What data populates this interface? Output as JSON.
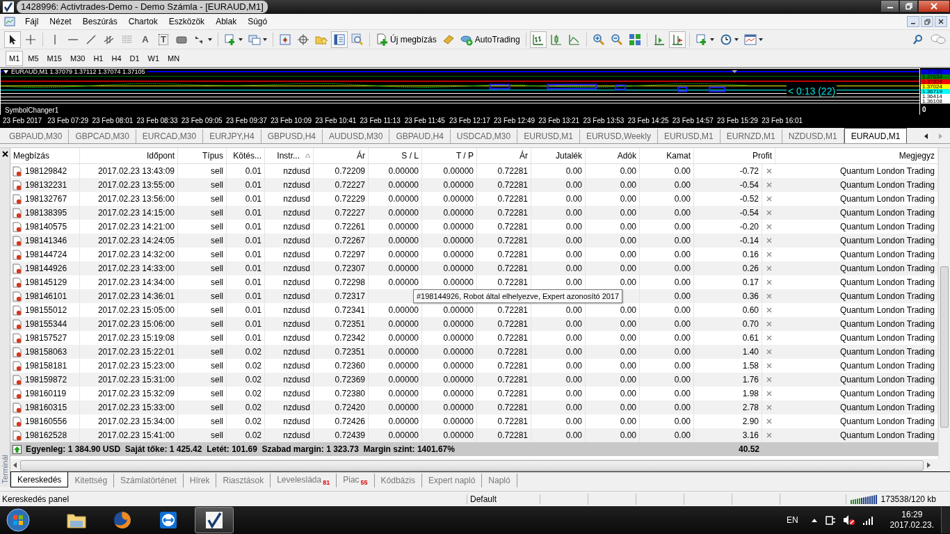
{
  "window": {
    "title": "1428996: Activtrades-Demo - Demo Számla - [EURAUD,M1]"
  },
  "menu": [
    "Fájl",
    "Nézet",
    "Beszúrás",
    "Chartok",
    "Eszközök",
    "Ablak",
    "Súgó"
  ],
  "toolbar": {
    "groups": [
      {
        "tools": [
          {
            "kind": "cursor",
            "pressed": true
          },
          {
            "kind": "crosshair",
            "pressed": false
          }
        ]
      },
      {
        "tools": [
          {
            "kind": "vline",
            "pressed": false
          },
          {
            "kind": "hline",
            "pressed": false
          },
          {
            "kind": "trendline",
            "pressed": false
          },
          {
            "kind": "channel",
            "pressed": false
          },
          {
            "kind": "fibo",
            "pressed": false
          },
          {
            "kind": "text",
            "glyph": "A",
            "pressed": false
          },
          {
            "kind": "label",
            "glyph": "T",
            "pressed": false
          },
          {
            "kind": "rectangle",
            "pressed": false
          },
          {
            "kind": "arrows",
            "pressed": false,
            "dropdown": true
          }
        ]
      },
      {
        "tools": [
          {
            "kind": "new-chart",
            "pressed": false,
            "dropdown": true
          },
          {
            "kind": "profiles",
            "pressed": false,
            "dropdown": true
          }
        ]
      },
      {
        "tools": [
          {
            "kind": "market-watch",
            "pressed": false
          },
          {
            "kind": "data-window",
            "pressed": false
          },
          {
            "kind": "navigator",
            "pressed": false
          },
          {
            "kind": "terminal",
            "pressed": true
          },
          {
            "kind": "tester",
            "pressed": false
          }
        ]
      },
      {
        "tools": [
          {
            "kind": "new-order",
            "label": "Új megbízás",
            "pressed": false
          },
          {
            "kind": "editor",
            "pressed": false
          },
          {
            "kind": "autotrading",
            "label": "AutoTrading",
            "pressed": false
          }
        ]
      },
      {
        "tools": [
          {
            "kind": "bars",
            "pressed": true
          },
          {
            "kind": "candles",
            "pressed": false
          },
          {
            "kind": "line",
            "pressed": false
          }
        ]
      },
      {
        "tools": [
          {
            "kind": "zoom-in",
            "pressed": false
          },
          {
            "kind": "zoom-out",
            "pressed": false
          },
          {
            "kind": "tile",
            "pressed": false
          }
        ]
      },
      {
        "tools": [
          {
            "kind": "autoscroll",
            "pressed": false
          },
          {
            "kind": "shift",
            "pressed": true
          }
        ]
      },
      {
        "tools": [
          {
            "kind": "indicators",
            "pressed": false,
            "dropdown": true
          },
          {
            "kind": "periods",
            "pressed": false,
            "dropdown": true
          },
          {
            "kind": "templates",
            "pressed": false,
            "dropdown": true
          }
        ]
      }
    ]
  },
  "timeframes": [
    {
      "label": "M1",
      "selected": true
    },
    {
      "label": "M5",
      "selected": false
    },
    {
      "label": "M15",
      "selected": false
    },
    {
      "label": "M30",
      "selected": false
    },
    {
      "label": "H1",
      "selected": false
    },
    {
      "label": "H4",
      "selected": false
    },
    {
      "label": "D1",
      "selected": false
    },
    {
      "label": "W1",
      "selected": false
    },
    {
      "label": "MN",
      "selected": false
    }
  ],
  "chart": {
    "header": "EURAUD,M1  1.37079 1.37112 1.37074 1.37105",
    "countdown": "< 0:13 (22)",
    "subwindow": "SymbolChanger1",
    "subwindow_scale": "0",
    "price_labels": [
      {
        "text": "1.37939",
        "color": "#0000ff"
      },
      {
        "text": "1.37634",
        "color": "#008000"
      },
      {
        "text": "1.37329",
        "color": "#ff0000"
      },
      {
        "text": "1.37024",
        "color": "#ffff00"
      },
      {
        "text": "1.36719",
        "color": "#00ffff"
      },
      {
        "text": "1.36414",
        "color": "#ffffff"
      },
      {
        "text": "1.36108",
        "color": "#ffffff"
      }
    ],
    "time_labels": [
      "23 Feb 2017",
      "23 Feb 07:29",
      "23 Feb 08:01",
      "23 Feb 08:33",
      "23 Feb 09:05",
      "23 Feb 09:37",
      "23 Feb 10:09",
      "23 Feb 10:41",
      "23 Feb 11:13",
      "23 Feb 11:45",
      "23 Feb 12:17",
      "23 Feb 12:49",
      "23 Feb 13:21",
      "23 Feb 13:53",
      "23 Feb 14:25",
      "23 Feb 14:57",
      "23 Feb 15:29",
      "23 Feb 16:01"
    ]
  },
  "chart_tabs": [
    {
      "label": "GBPAUD,M30",
      "selected": false
    },
    {
      "label": "GBPCAD,M30",
      "selected": false
    },
    {
      "label": "EURCAD,M30",
      "selected": false
    },
    {
      "label": "EURJPY,H4",
      "selected": false
    },
    {
      "label": "GBPUSD,H4",
      "selected": false
    },
    {
      "label": "AUDUSD,M30",
      "selected": false
    },
    {
      "label": "GBPAUD,H4",
      "selected": false
    },
    {
      "label": "USDCAD,M30",
      "selected": false
    },
    {
      "label": "EURUSD,M1",
      "selected": false
    },
    {
      "label": "EURUSD,Weekly",
      "selected": false
    },
    {
      "label": "EURUSD,M1",
      "selected": false
    },
    {
      "label": "EURNZD,M1",
      "selected": false
    },
    {
      "label": "NZDUSD,M1",
      "selected": false
    },
    {
      "label": "EURAUD,M1",
      "selected": true
    }
  ],
  "terminal": {
    "side_label": "Terminál",
    "columns": [
      "Megbízás",
      "Időpont",
      "Típus",
      "Kötés...",
      "Instr...",
      "Ár",
      "S / L",
      "T / P",
      "Ár",
      "Jutalék",
      "Adók",
      "Kamat",
      "Profit",
      "Megjegyz"
    ],
    "rows": [
      {
        "order": "198129842",
        "time": "2017.02.23 13:43:09",
        "type": "sell",
        "size": "0.01",
        "symbol": "nzdusd",
        "price": "0.72209",
        "sl": "0.00000",
        "tp": "0.00000",
        "current_price": "0.72281",
        "commission": "0.00",
        "taxes": "0.00",
        "swap": "0.00",
        "profit": "-0.72",
        "comment": "Quantum London Trading"
      },
      {
        "order": "198132231",
        "time": "2017.02.23 13:55:00",
        "type": "sell",
        "size": "0.01",
        "symbol": "nzdusd",
        "price": "0.72227",
        "sl": "0.00000",
        "tp": "0.00000",
        "current_price": "0.72281",
        "commission": "0.00",
        "taxes": "0.00",
        "swap": "0.00",
        "profit": "-0.54",
        "comment": "Quantum London Trading"
      },
      {
        "order": "198132767",
        "time": "2017.02.23 13:56:00",
        "type": "sell",
        "size": "0.01",
        "symbol": "nzdusd",
        "price": "0.72229",
        "sl": "0.00000",
        "tp": "0.00000",
        "current_price": "0.72281",
        "commission": "0.00",
        "taxes": "0.00",
        "swap": "0.00",
        "profit": "-0.52",
        "comment": "Quantum London Trading"
      },
      {
        "order": "198138395",
        "time": "2017.02.23 14:15:00",
        "type": "sell",
        "size": "0.01",
        "symbol": "nzdusd",
        "price": "0.72227",
        "sl": "0.00000",
        "tp": "0.00000",
        "current_price": "0.72281",
        "commission": "0.00",
        "taxes": "0.00",
        "swap": "0.00",
        "profit": "-0.54",
        "comment": "Quantum London Trading"
      },
      {
        "order": "198140575",
        "time": "2017.02.23 14:21:00",
        "type": "sell",
        "size": "0.01",
        "symbol": "nzdusd",
        "price": "0.72261",
        "sl": "0.00000",
        "tp": "0.00000",
        "current_price": "0.72281",
        "commission": "0.00",
        "taxes": "0.00",
        "swap": "0.00",
        "profit": "-0.20",
        "comment": "Quantum London Trading"
      },
      {
        "order": "198141346",
        "time": "2017.02.23 14:24:05",
        "type": "sell",
        "size": "0.01",
        "symbol": "nzdusd",
        "price": "0.72267",
        "sl": "0.00000",
        "tp": "0.00000",
        "current_price": "0.72281",
        "commission": "0.00",
        "taxes": "0.00",
        "swap": "0.00",
        "profit": "-0.14",
        "comment": "Quantum London Trading"
      },
      {
        "order": "198144724",
        "time": "2017.02.23 14:32:00",
        "type": "sell",
        "size": "0.01",
        "symbol": "nzdusd",
        "price": "0.72297",
        "sl": "0.00000",
        "tp": "0.00000",
        "current_price": "0.72281",
        "commission": "0.00",
        "taxes": "0.00",
        "swap": "0.00",
        "profit": "0.16",
        "comment": "Quantum London Trading"
      },
      {
        "order": "198144926",
        "time": "2017.02.23 14:33:00",
        "type": "sell",
        "size": "0.01",
        "symbol": "nzdusd",
        "price": "0.72307",
        "sl": "0.00000",
        "tp": "0.00000",
        "current_price": "0.72281",
        "commission": "0.00",
        "taxes": "0.00",
        "swap": "0.00",
        "profit": "0.26",
        "comment": "Quantum London Trading"
      },
      {
        "order": "198145129",
        "time": "2017.02.23 14:34:00",
        "type": "sell",
        "size": "0.01",
        "symbol": "nzdusd",
        "price": "0.72298",
        "sl": "0.00000",
        "tp": "0.00000",
        "current_price": "0.72281",
        "commission": "0.00",
        "taxes": "0.00",
        "swap": "0.00",
        "profit": "0.17",
        "comment": "Quantum London Trading"
      },
      {
        "order": "198146101",
        "time": "2017.02.23 14:36:01",
        "type": "sell",
        "size": "0.01",
        "symbol": "nzdusd",
        "price": "0.72317",
        "swap": "0.00",
        "profit": "0.36",
        "comment": "Quantum London Trading"
      },
      {
        "order": "198155012",
        "time": "2017.02.23 15:05:00",
        "type": "sell",
        "size": "0.01",
        "symbol": "nzdusd",
        "price": "0.72341",
        "sl": "0.00000",
        "tp": "0.00000",
        "current_price": "0.72281",
        "commission": "0.00",
        "taxes": "0.00",
        "swap": "0.00",
        "profit": "0.60",
        "comment": "Quantum London Trading"
      },
      {
        "order": "198155344",
        "time": "2017.02.23 15:06:00",
        "type": "sell",
        "size": "0.01",
        "symbol": "nzdusd",
        "price": "0.72351",
        "sl": "0.00000",
        "tp": "0.00000",
        "current_price": "0.72281",
        "commission": "0.00",
        "taxes": "0.00",
        "swap": "0.00",
        "profit": "0.70",
        "comment": "Quantum London Trading"
      },
      {
        "order": "198157527",
        "time": "2017.02.23 15:19:08",
        "type": "sell",
        "size": "0.01",
        "symbol": "nzdusd",
        "price": "0.72342",
        "sl": "0.00000",
        "tp": "0.00000",
        "current_price": "0.72281",
        "commission": "0.00",
        "taxes": "0.00",
        "swap": "0.00",
        "profit": "0.61",
        "comment": "Quantum London Trading"
      },
      {
        "order": "198158063",
        "time": "2017.02.23 15:22:01",
        "type": "sell",
        "size": "0.02",
        "symbol": "nzdusd",
        "price": "0.72351",
        "sl": "0.00000",
        "tp": "0.00000",
        "current_price": "0.72281",
        "commission": "0.00",
        "taxes": "0.00",
        "swap": "0.00",
        "profit": "1.40",
        "comment": "Quantum London Trading"
      },
      {
        "order": "198158181",
        "time": "2017.02.23 15:23:00",
        "type": "sell",
        "size": "0.02",
        "symbol": "nzdusd",
        "price": "0.72360",
        "sl": "0.00000",
        "tp": "0.00000",
        "current_price": "0.72281",
        "commission": "0.00",
        "taxes": "0.00",
        "swap": "0.00",
        "profit": "1.58",
        "comment": "Quantum London Trading"
      },
      {
        "order": "198159872",
        "time": "2017.02.23 15:31:00",
        "type": "sell",
        "size": "0.02",
        "symbol": "nzdusd",
        "price": "0.72369",
        "sl": "0.00000",
        "tp": "0.00000",
        "current_price": "0.72281",
        "commission": "0.00",
        "taxes": "0.00",
        "swap": "0.00",
        "profit": "1.76",
        "comment": "Quantum London Trading"
      },
      {
        "order": "198160119",
        "time": "2017.02.23 15:32:09",
        "type": "sell",
        "size": "0.02",
        "symbol": "nzdusd",
        "price": "0.72380",
        "sl": "0.00000",
        "tp": "0.00000",
        "current_price": "0.72281",
        "commission": "0.00",
        "taxes": "0.00",
        "swap": "0.00",
        "profit": "1.98",
        "comment": "Quantum London Trading"
      },
      {
        "order": "198160315",
        "time": "2017.02.23 15:33:00",
        "type": "sell",
        "size": "0.02",
        "symbol": "nzdusd",
        "price": "0.72420",
        "sl": "0.00000",
        "tp": "0.00000",
        "current_price": "0.72281",
        "commission": "0.00",
        "taxes": "0.00",
        "swap": "0.00",
        "profit": "2.78",
        "comment": "Quantum London Trading"
      },
      {
        "order": "198160556",
        "time": "2017.02.23 15:34:00",
        "type": "sell",
        "size": "0.02",
        "symbol": "nzdusd",
        "price": "0.72426",
        "sl": "0.00000",
        "tp": "0.00000",
        "current_price": "0.72281",
        "commission": "0.00",
        "taxes": "0.00",
        "swap": "0.00",
        "profit": "2.90",
        "comment": "Quantum London Trading"
      },
      {
        "order": "198162528",
        "time": "2017.02.23 15:41:00",
        "type": "sell",
        "size": "0.02",
        "symbol": "nzdusd",
        "price": "0.72439",
        "sl": "0.00000",
        "tp": "0.00000",
        "current_price": "0.72281",
        "commission": "0.00",
        "taxes": "0.00",
        "swap": "0.00",
        "profit": "3.16",
        "comment": "Quantum London Trading"
      }
    ],
    "tooltip": "#198144926, Robot által elhelyezve, Expert azonosító 2017",
    "summary": "Egyenleg: 1 384.90 USD  Saját tőke: 1 425.42  Letét: 101.69  Szabad margin: 1 323.73  Margin szint: 1401.67%",
    "total_profit": "40.52",
    "tabs": [
      {
        "label": "Kereskedés",
        "selected": true
      },
      {
        "label": "Kitettség",
        "selected": false
      },
      {
        "label": "Számlatörténet",
        "selected": false
      },
      {
        "label": "Hírek",
        "selected": false
      },
      {
        "label": "Riasztások",
        "selected": false
      },
      {
        "label": "Levelesláda",
        "badge": "81",
        "selected": false
      },
      {
        "label": "Piac",
        "badge": "55",
        "selected": false
      },
      {
        "label": "Kódbázis",
        "selected": false
      },
      {
        "label": "Expert napló",
        "selected": false
      },
      {
        "label": "Napló",
        "selected": false
      }
    ]
  },
  "status_bar": {
    "fields": [
      "Kereskedés panel",
      "Default"
    ],
    "connection": "173538/120 kb"
  },
  "taskbar": {
    "apps": [
      {
        "kind": "folder",
        "active": false
      },
      {
        "kind": "browser",
        "active": false
      },
      {
        "kind": "remote",
        "active": false
      },
      {
        "kind": "trader",
        "active": true
      }
    ],
    "language": "EN",
    "time": "16:29",
    "date": "2017.02.23."
  }
}
